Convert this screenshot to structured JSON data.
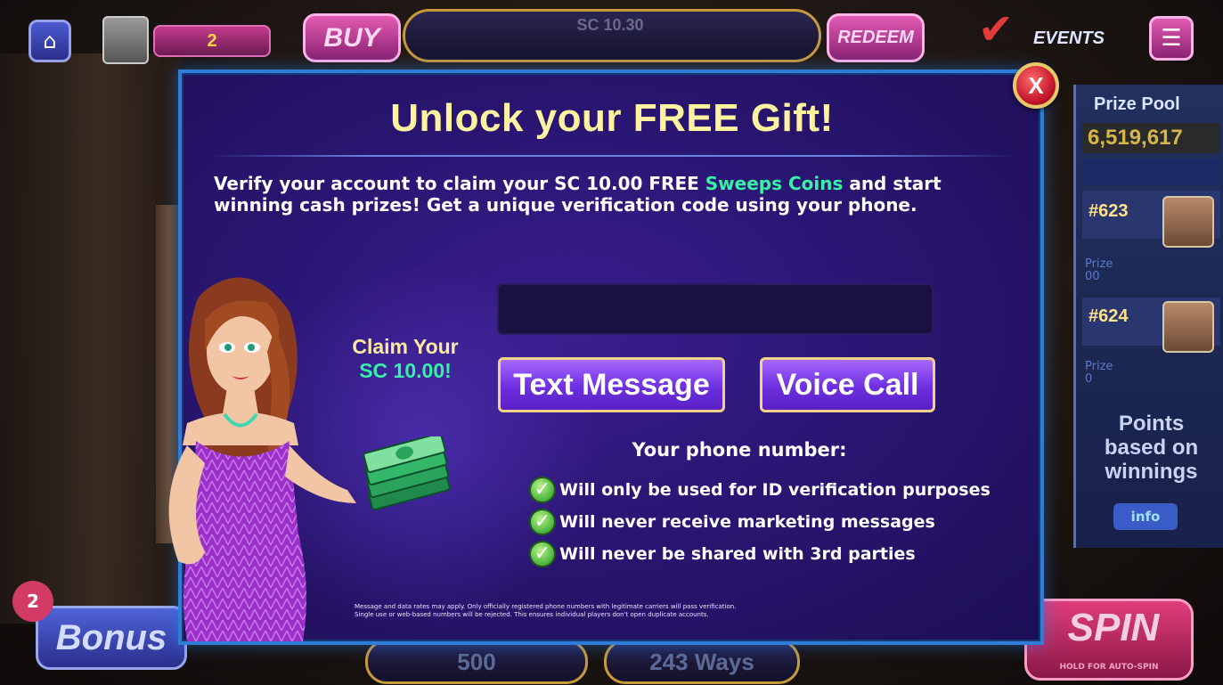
{
  "top_bar": {
    "level": "2",
    "buy_label": "BUY",
    "coin_readout": "SC 10.30",
    "redeem_label": "REDEEM",
    "events_label": "EVENTS"
  },
  "prize_panel": {
    "title": "Prize Pool",
    "value": "6,519,617",
    "rank_1": "#623",
    "prize_1_label": "Prize",
    "prize_1_value": "00",
    "rank_2": "#624",
    "prize_2_label": "Prize",
    "prize_2_value": "0",
    "points_text_line1": "Points",
    "points_text_line2": "based on",
    "points_text_line3": "winnings",
    "info_label": "info"
  },
  "bottom_bar": {
    "bonus_count": "2",
    "bonus_label": "Bonus",
    "bet_value": "500",
    "ways_value": "243 Ways",
    "spin_label": "SPIN",
    "spin_sub": "HOLD FOR AUTO-SPIN"
  },
  "modal": {
    "title": "Unlock your FREE Gift!",
    "desc_part1": "Verify your account to claim your SC 10.00 FREE ",
    "desc_highlight": "Sweeps Coins",
    "desc_part2": " and start winning cash prizes! Get a unique verification code using your phone.",
    "close_label": "X",
    "phone_input_value": "",
    "claim_line1": "Claim Your",
    "claim_line2": "SC 10.00!",
    "text_message_label": "Text Message",
    "voice_call_label": "Voice Call",
    "phone_heading": "Your phone number:",
    "bullets": [
      "Will only be used for ID verification purposes",
      "Will never receive marketing messages",
      "Will never be shared with 3rd parties"
    ],
    "fine_print_line1": "Message and data rates may apply. Only officially registered phone numbers with legitimate carriers will pass verification.",
    "fine_print_line2": "Single use or web-based numbers will be rejected. This ensures individual players don't open duplicate accounts."
  },
  "colors": {
    "accent_green": "#38f0a6",
    "title_yellow": "#fff3a0",
    "modal_border": "#2f7dd6",
    "button_purple": "#6d2fe1",
    "close_red": "#c0142a"
  },
  "icons": {
    "home": "home-icon",
    "menu": "hamburger-menu-icon",
    "close": "close-icon",
    "check": "checkmark-icon",
    "cash": "cash-stack-icon"
  }
}
